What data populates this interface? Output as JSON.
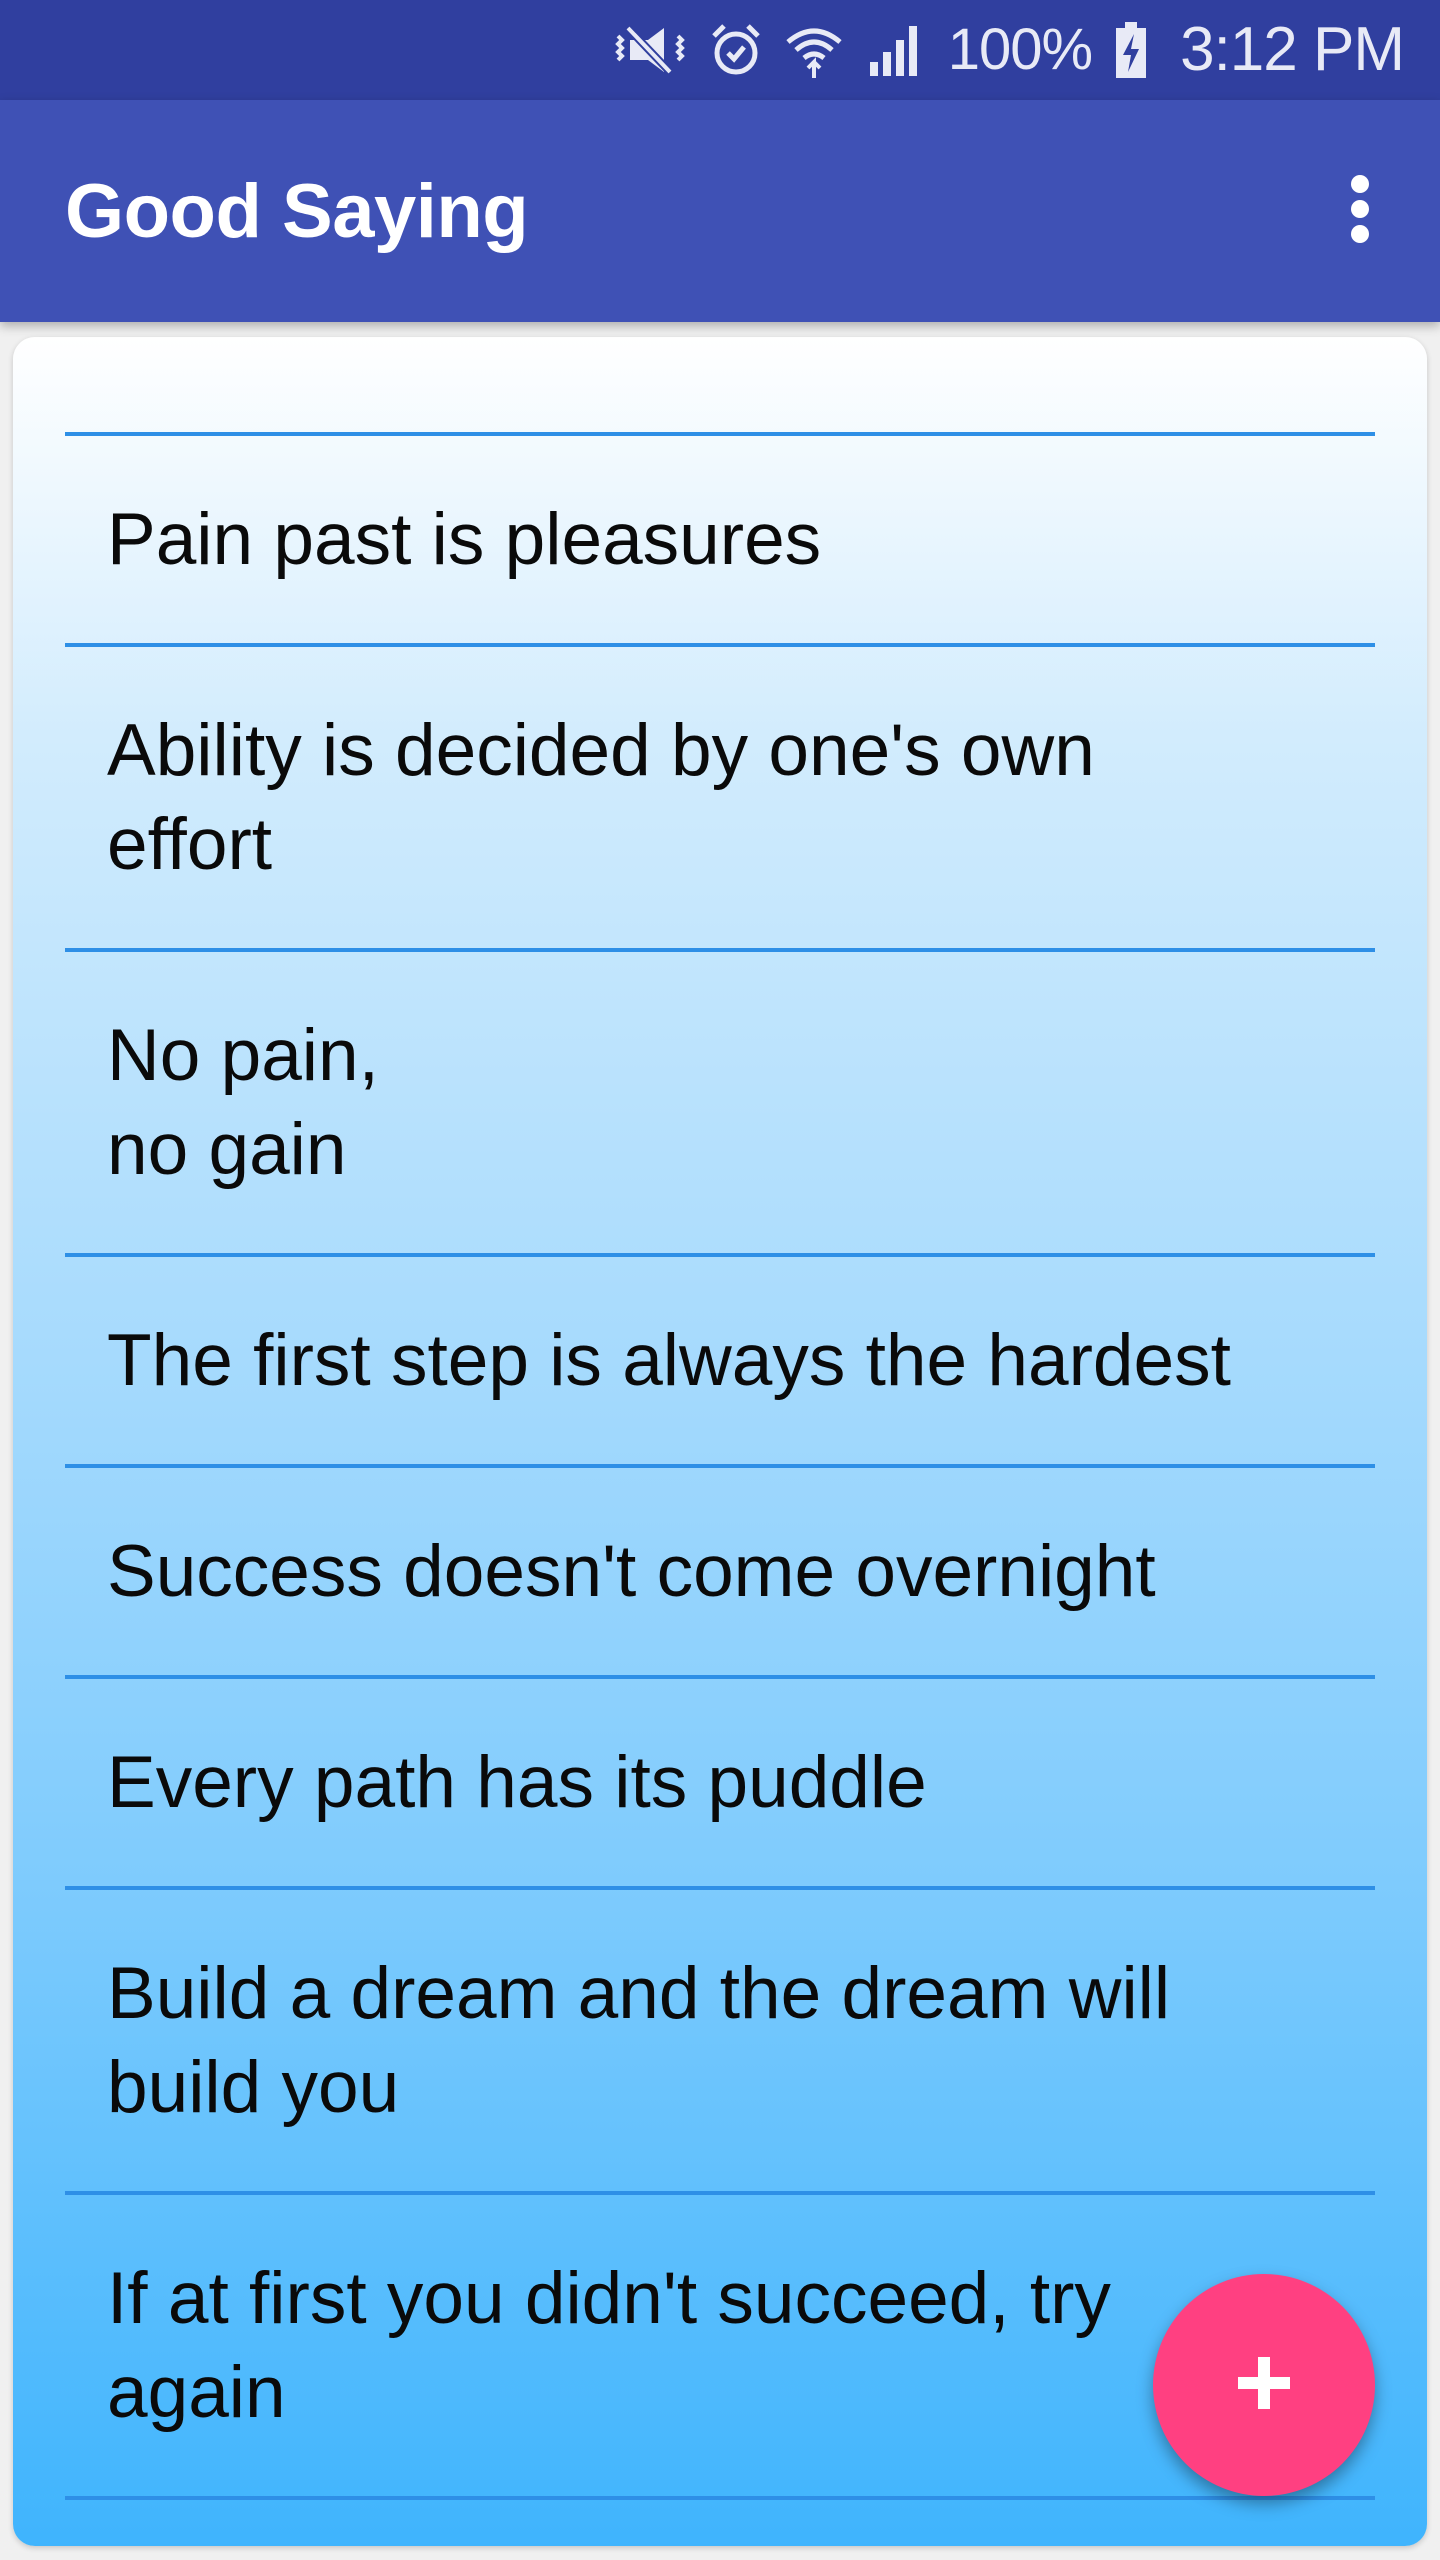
{
  "status_bar": {
    "battery_percent": "100%",
    "time": "3:12 PM",
    "icons": [
      "vibrate-mute-icon",
      "alarm-icon",
      "wifi-icon",
      "signal-icon",
      "battery-charging-icon"
    ]
  },
  "app_bar": {
    "title": "Good Saying",
    "menu_icon": "more-vert-icon"
  },
  "sayings": [
    "Pain past is pleasures",
    "Ability is decided by one's own\neffort",
    "No pain,\nno gain",
    "The first step is always the hardest",
    "Success doesn't come overnight",
    "Every path has its puddle",
    "Build a dream and the dream will\nbuild you",
    "If at first you didn't succeed, try\nagain"
  ],
  "fab": {
    "icon": "plus-icon"
  },
  "colors": {
    "status_bar": "#303f9f",
    "primary": "#3f51b5",
    "accent": "#ff4081",
    "divider": "#2e8fe6",
    "gradient_top": "#ffffff",
    "gradient_bottom": "#3fb4fd"
  }
}
